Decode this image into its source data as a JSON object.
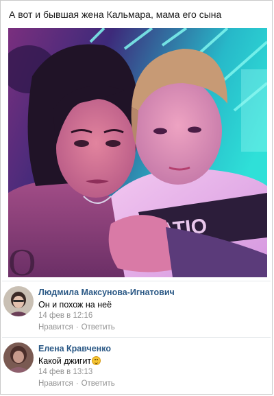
{
  "post": {
    "text": "А вот и бывшая жена Кальмара, мама его сына"
  },
  "comments": [
    {
      "author": "Людмила Максунова-Игнатович",
      "text": "Он и похож на неё",
      "date": "14 фев в 12:16",
      "like_label": "Нравится",
      "reply_label": "Ответить"
    },
    {
      "author": "Елена Кравченко",
      "text": "Какой джигит",
      "emoji": "grinning-face-emoji",
      "date": "14 фев в 13:13",
      "like_label": "Нравится",
      "reply_label": "Ответить"
    }
  ],
  "colors": {
    "link": "#2a5885",
    "meta": "#939393",
    "divider": "#e3e6ea"
  }
}
